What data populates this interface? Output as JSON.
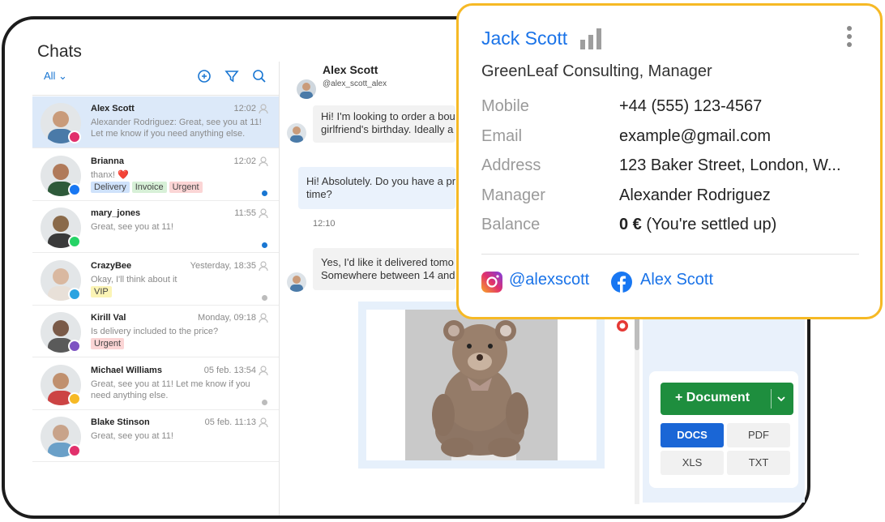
{
  "page_title": "Chats",
  "filter": {
    "label": "All ⌄"
  },
  "chats": [
    {
      "name": "Alex Scott",
      "time": "12:02",
      "message": "Alexander Rodriguez: Great, see you at 11! Let me know if you need anything else.",
      "channel": "instagram",
      "tags": [],
      "status": "none"
    },
    {
      "name": "Brianna",
      "time": "12:02",
      "message": "thanx! ❤️",
      "channel": "facebook",
      "tags": [
        "Delivery",
        "Invoice",
        "Urgent"
      ],
      "status": "unread"
    },
    {
      "name": "mary_jones",
      "time": "11:55",
      "message": "Great, see you at 11!",
      "channel": "whatsapp",
      "tags": [],
      "status": "unread"
    },
    {
      "name": "CrazyBee",
      "time": "Yesterday, 18:35",
      "message": "Okay, I'll think about it",
      "channel": "telegram",
      "tags": [
        "VIP"
      ],
      "status": "read"
    },
    {
      "name": "Kirill Val",
      "time": "Monday, 09:18",
      "message": "Is delivery included to the price?",
      "channel": "viber",
      "tags": [
        "Urgent"
      ],
      "status": "none"
    },
    {
      "name": "Michael Williams",
      "time": "05 feb. 13:54",
      "message": "Great, see you at 11! Let me know if you need anything else.",
      "channel": "other",
      "tags": [],
      "status": "read"
    },
    {
      "name": "Blake Stinson",
      "time": "05 feb. 11:13",
      "message": "Great, see you at 11!",
      "channel": "instagram",
      "tags": [],
      "status": "none"
    }
  ],
  "tag_colors": {
    "Delivery": "#cfe2fb",
    "Invoice": "#d7f0d7",
    "Urgent": "#fbd5d5",
    "VIP": "#fbf4b5"
  },
  "conversation": {
    "name": "Alex Scott",
    "handle": "@alex_scott_alex",
    "messages": [
      {
        "text": "Hi! I'm looking to order a bou",
        "text2": "girlfriend's birthday. Ideally a",
        "dir": "in"
      },
      {
        "text": "Hi! Absolutely. Do you have a pr",
        "text2": "time?",
        "dir": "out"
      },
      {
        "text": "Yes, I'd like it delivered tomo",
        "text2": "Somewhere between 14 and",
        "dir": "in"
      }
    ],
    "time_label": "12:10"
  },
  "document": {
    "button_label": "+ Document",
    "formats": [
      "DOCS",
      "PDF",
      "XLS",
      "TXT"
    ],
    "selected": "DOCS"
  },
  "contact": {
    "name": "Jack Scott",
    "company": "GreenLeaf Consulting, Manager",
    "fields": [
      {
        "label": "Mobile",
        "value": "+44 (555) 123-4567"
      },
      {
        "label": "Email",
        "value": "example@gmail.com"
      },
      {
        "label": "Address",
        "value": "123 Baker Street, London, W..."
      },
      {
        "label": "Manager",
        "value": "Alexander Rodriguez"
      }
    ],
    "balance_label": "Balance",
    "balance_amount": "0 €",
    "balance_note": " (You're settled up)",
    "instagram": "@alexscott",
    "facebook": "Alex Scott"
  },
  "colors": {
    "accent": "#1a73e8",
    "card_border": "#f6b925",
    "active_row": "#dce9f9",
    "doc_button": "#1e8e3e"
  }
}
